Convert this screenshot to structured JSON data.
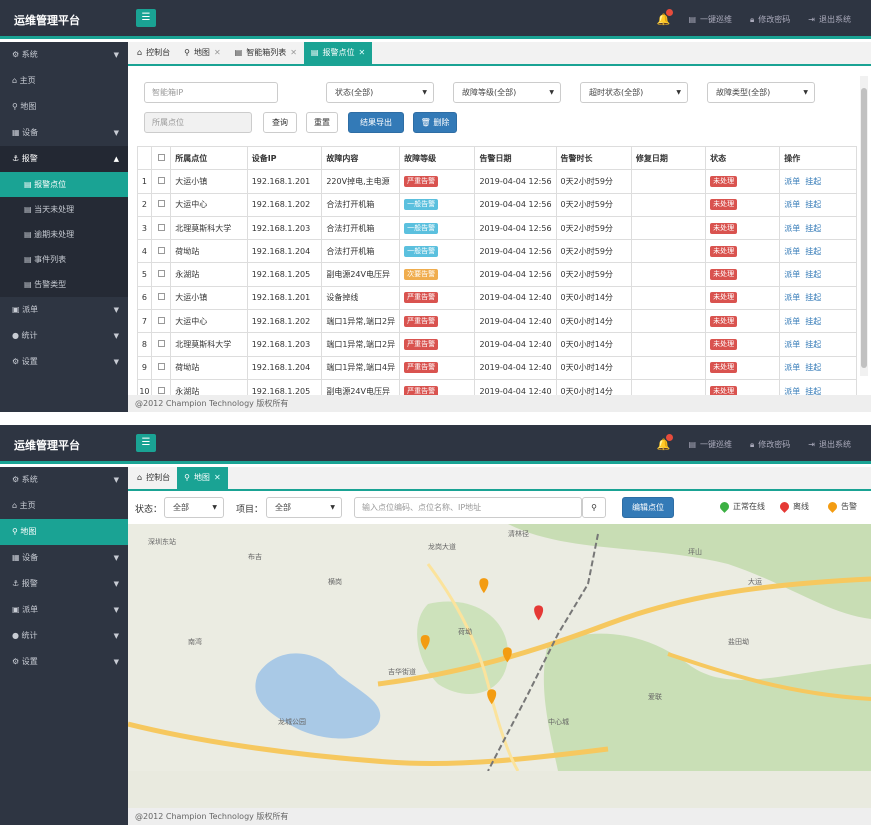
{
  "app": {
    "title": "运维管理平台"
  },
  "topnav": {
    "alarm": "一键巡维",
    "password": "修改密码",
    "logout": "退出系统"
  },
  "sidebar1": [
    {
      "label": "系统",
      "icon": "gear-icon"
    },
    {
      "label": "主页",
      "icon": "home-icon"
    },
    {
      "label": "地图",
      "icon": "map-pin-icon"
    },
    {
      "label": "设备",
      "icon": "device-icon"
    },
    {
      "label": "报警",
      "icon": "anchor-icon"
    }
  ],
  "sidebar1_sub": [
    "报警点位",
    "当天未处理",
    "逾期未处理",
    "事件列表",
    "告警类型"
  ],
  "sidebar1_rest": [
    {
      "label": "派单",
      "icon": "dispatch-icon"
    },
    {
      "label": "统计",
      "icon": "stats-icon"
    },
    {
      "label": "设置",
      "icon": "gear-icon"
    }
  ],
  "tabs1": [
    "控制台",
    "地图",
    "智能箱列表",
    "报警点位"
  ],
  "filters": {
    "ip_placeholder": "智能箱IP",
    "status": "状态(全部)",
    "level": "故障等级(全部)",
    "timeout": "超时状态(全部)",
    "type": "故障类型(全部)",
    "location_placeholder": "所属点位",
    "query": "查询",
    "reset": "重置",
    "export": "结果导出",
    "delete": "删除"
  },
  "table": {
    "headers": [
      "所属点位",
      "设备IP",
      "故障内容",
      "故障等级",
      "告警日期",
      "告警时长",
      "修复日期",
      "状态",
      "操作"
    ],
    "actions": [
      "派单",
      "挂起"
    ],
    "rows": [
      {
        "n": "1",
        "loc": "大运小镇",
        "ip": "192.168.1.201",
        "content": "220V掉电,主电源",
        "level": "严重告警",
        "lc": "red",
        "date": "2019-04-04 12:56",
        "dur": "0天2小时59分",
        "fix": "",
        "status": "未处理"
      },
      {
        "n": "2",
        "loc": "大运中心",
        "ip": "192.168.1.202",
        "content": "合法打开机箱",
        "level": "一般告警",
        "lc": "blue",
        "date": "2019-04-04 12:56",
        "dur": "0天2小时59分",
        "fix": "",
        "status": "未处理"
      },
      {
        "n": "3",
        "loc": "北理莫斯科大学",
        "ip": "192.168.1.203",
        "content": "合法打开机箱",
        "level": "一般告警",
        "lc": "blue",
        "date": "2019-04-04 12:56",
        "dur": "0天2小时59分",
        "fix": "",
        "status": "未处理"
      },
      {
        "n": "4",
        "loc": "荷坳站",
        "ip": "192.168.1.204",
        "content": "合法打开机箱",
        "level": "一般告警",
        "lc": "blue",
        "date": "2019-04-04 12:56",
        "dur": "0天2小时59分",
        "fix": "",
        "status": "未处理"
      },
      {
        "n": "5",
        "loc": "永湖站",
        "ip": "192.168.1.205",
        "content": "副电源24V电压异",
        "level": "次要告警",
        "lc": "orange",
        "date": "2019-04-04 12:56",
        "dur": "0天2小时59分",
        "fix": "",
        "status": "未处理"
      },
      {
        "n": "6",
        "loc": "大运小镇",
        "ip": "192.168.1.201",
        "content": "设备掉线",
        "level": "严重告警",
        "lc": "red",
        "date": "2019-04-04 12:40",
        "dur": "0天0小时14分",
        "fix": "",
        "status": "未处理"
      },
      {
        "n": "7",
        "loc": "大运中心",
        "ip": "192.168.1.202",
        "content": "端口1异常,端口2异",
        "level": "严重告警",
        "lc": "red",
        "date": "2019-04-04 12:40",
        "dur": "0天0小时14分",
        "fix": "",
        "status": "未处理"
      },
      {
        "n": "8",
        "loc": "北理莫斯科大学",
        "ip": "192.168.1.203",
        "content": "端口1异常,端口2异",
        "level": "严重告警",
        "lc": "red",
        "date": "2019-04-04 12:40",
        "dur": "0天0小时14分",
        "fix": "",
        "status": "未处理"
      },
      {
        "n": "9",
        "loc": "荷坳站",
        "ip": "192.168.1.204",
        "content": "端口1异常,端口4异",
        "level": "严重告警",
        "lc": "red",
        "date": "2019-04-04 12:40",
        "dur": "0天0小时14分",
        "fix": "",
        "status": "未处理"
      },
      {
        "n": "10",
        "loc": "永湖站",
        "ip": "192.168.1.205",
        "content": "副电源24V电压异",
        "level": "严重告警",
        "lc": "red",
        "date": "2019-04-04 12:40",
        "dur": "0天0小时14分",
        "fix": "",
        "status": "未处理"
      }
    ]
  },
  "footer": "@2012 Champion Technology 版权所有",
  "sidebar2": [
    {
      "label": "系统"
    },
    {
      "label": "主页"
    },
    {
      "label": "地图"
    },
    {
      "label": "设备"
    },
    {
      "label": "报警"
    },
    {
      "label": "派单"
    },
    {
      "label": "统计"
    },
    {
      "label": "设置"
    }
  ],
  "tabs2": [
    "控制台",
    "地图"
  ],
  "map": {
    "status_label": "状态：",
    "status_value": "全部",
    "project_label": "项目：",
    "project_value": "全部",
    "search_placeholder": "输入点位编码、点位名称、IP地址",
    "edit_button": "编辑点位",
    "legend": [
      "正常在线",
      "离线",
      "告警"
    ],
    "legend_colors": [
      "#3cb043",
      "#e53935",
      "#f39c12"
    ],
    "markers": [
      {
        "type": "告警",
        "lng": 114.241,
        "lat": 22.712
      },
      {
        "type": "离线",
        "lng": 114.255,
        "lat": 22.701
      },
      {
        "type": "告警",
        "lng": 114.226,
        "lat": 22.689
      },
      {
        "type": "告警",
        "lng": 114.247,
        "lat": 22.684
      },
      {
        "type": "告警",
        "lng": 114.243,
        "lat": 22.667
      }
    ],
    "places": [
      "深圳东站",
      "布吉",
      "横岗",
      "龙岗大道",
      "清林径",
      "坪山",
      "大运",
      "荷坳",
      "龙城公园",
      "爱联",
      "吉华街道",
      "中心城",
      "南湾",
      "盐田坳"
    ]
  }
}
